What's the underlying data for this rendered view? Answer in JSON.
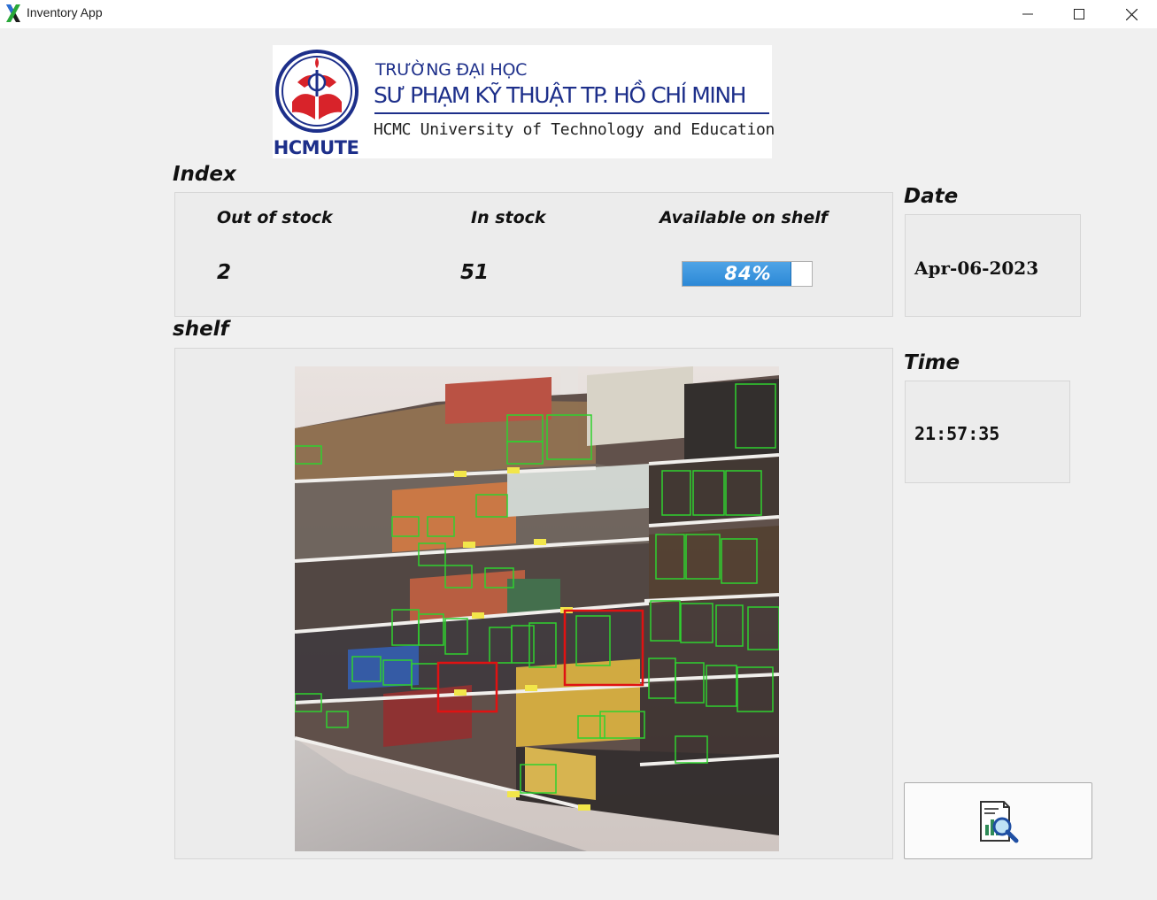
{
  "window": {
    "title": "Inventory App",
    "icon": "app-x-icon",
    "controls": [
      "minimize-icon",
      "maximize-icon",
      "close-icon"
    ]
  },
  "logo": {
    "abbr": "HCMUTE",
    "line1": "TRƯỜNG ĐẠI HỌC",
    "line2": "SƯ PHẠM KỸ THUẬT TP. HỒ CHÍ MINH",
    "line3": "HCMC University of Technology and Education",
    "brand_color": "#1d2f8a",
    "seal_color": "#d8232a"
  },
  "index": {
    "label": "Index",
    "out_of_stock_label": "Out of stock",
    "in_stock_label": "In stock",
    "available_label": "Available on shelf",
    "out_of_stock_value": "2",
    "in_stock_value": "51",
    "available_percent": 84,
    "available_text": "84%"
  },
  "shelf": {
    "label": "shelf",
    "detections": {
      "in_stock_box_color": "#2fd12f",
      "out_of_stock_box_color": "#e01212"
    }
  },
  "date": {
    "label": "Date",
    "value": "Apr-06-2023"
  },
  "time": {
    "label": "Time",
    "value": "21:57:35"
  },
  "analyze_button": {
    "icon": "report-search-icon"
  }
}
